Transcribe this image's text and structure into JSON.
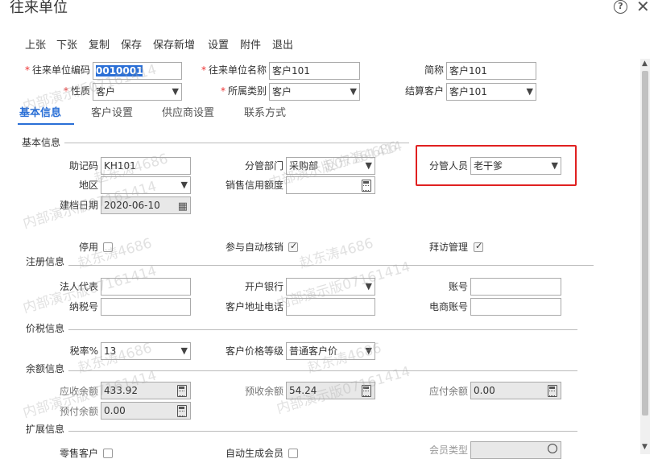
{
  "window": {
    "title": "往来单位",
    "help_icon": "?",
    "close_icon": "✕"
  },
  "toolbar": [
    "上张",
    "下张",
    "复制",
    "保存",
    "保存新增",
    "设置",
    "附件",
    "退出"
  ],
  "header": {
    "code_label": "往来单位编码",
    "code_value": "0010001",
    "name_label": "往来单位名称",
    "name_value": "客户101",
    "short_label": "简称",
    "short_value": "客户101",
    "nature_label": "性质",
    "nature_value": "客户",
    "category_label": "所属类别",
    "category_value": "客户",
    "settle_label": "结算客户",
    "settle_value": "客户101"
  },
  "tabs": [
    "基本信息",
    "客户设置",
    "供应商设置",
    "联系方式"
  ],
  "basic": {
    "section": "基本信息",
    "mnemonic_label": "助记码",
    "mnemonic_value": "KH101",
    "dept_label": "分管部门",
    "dept_value": "采购部",
    "person_label": "分管人员",
    "person_value": "老干爹",
    "region_label": "地区",
    "region_value": "",
    "credit_label": "销售信用额度",
    "credit_value": "",
    "date_label": "建档日期",
    "date_value": "2020-06-10",
    "disabled_label": "停用",
    "auto_verify_label": "参与自动核销",
    "visit_label": "拜访管理"
  },
  "register": {
    "section": "注册信息",
    "legal_label": "法人代表",
    "legal_value": "",
    "bank_label": "开户银行",
    "bank_value": "",
    "account_label": "账号",
    "account_value": "",
    "tax_label": "纳税号",
    "tax_value": "",
    "addr_label": "客户地址电话",
    "addr_value": "",
    "ecom_label": "电商账号",
    "ecom_value": ""
  },
  "price": {
    "section": "价税信息",
    "taxrate_label": "税率%",
    "taxrate_value": "13",
    "level_label": "客户价格等级",
    "level_value": "普通客户价"
  },
  "balance": {
    "section": "余额信息",
    "ar_label": "应收余额",
    "ar_value": "433.92",
    "adv_recv_label": "预收余额",
    "adv_recv_value": "54.24",
    "ap_label": "应付余额",
    "ap_value": "0.00",
    "prepay_label": "预付余额",
    "prepay_value": "0.00"
  },
  "ext": {
    "section": "扩展信息",
    "retail_label": "零售客户",
    "auto_member_label": "自动生成会员",
    "member_type_label": "会员类型",
    "member_type_value": ""
  },
  "watermark": [
    "赵东涛4686",
    "内部演示版07161414"
  ]
}
